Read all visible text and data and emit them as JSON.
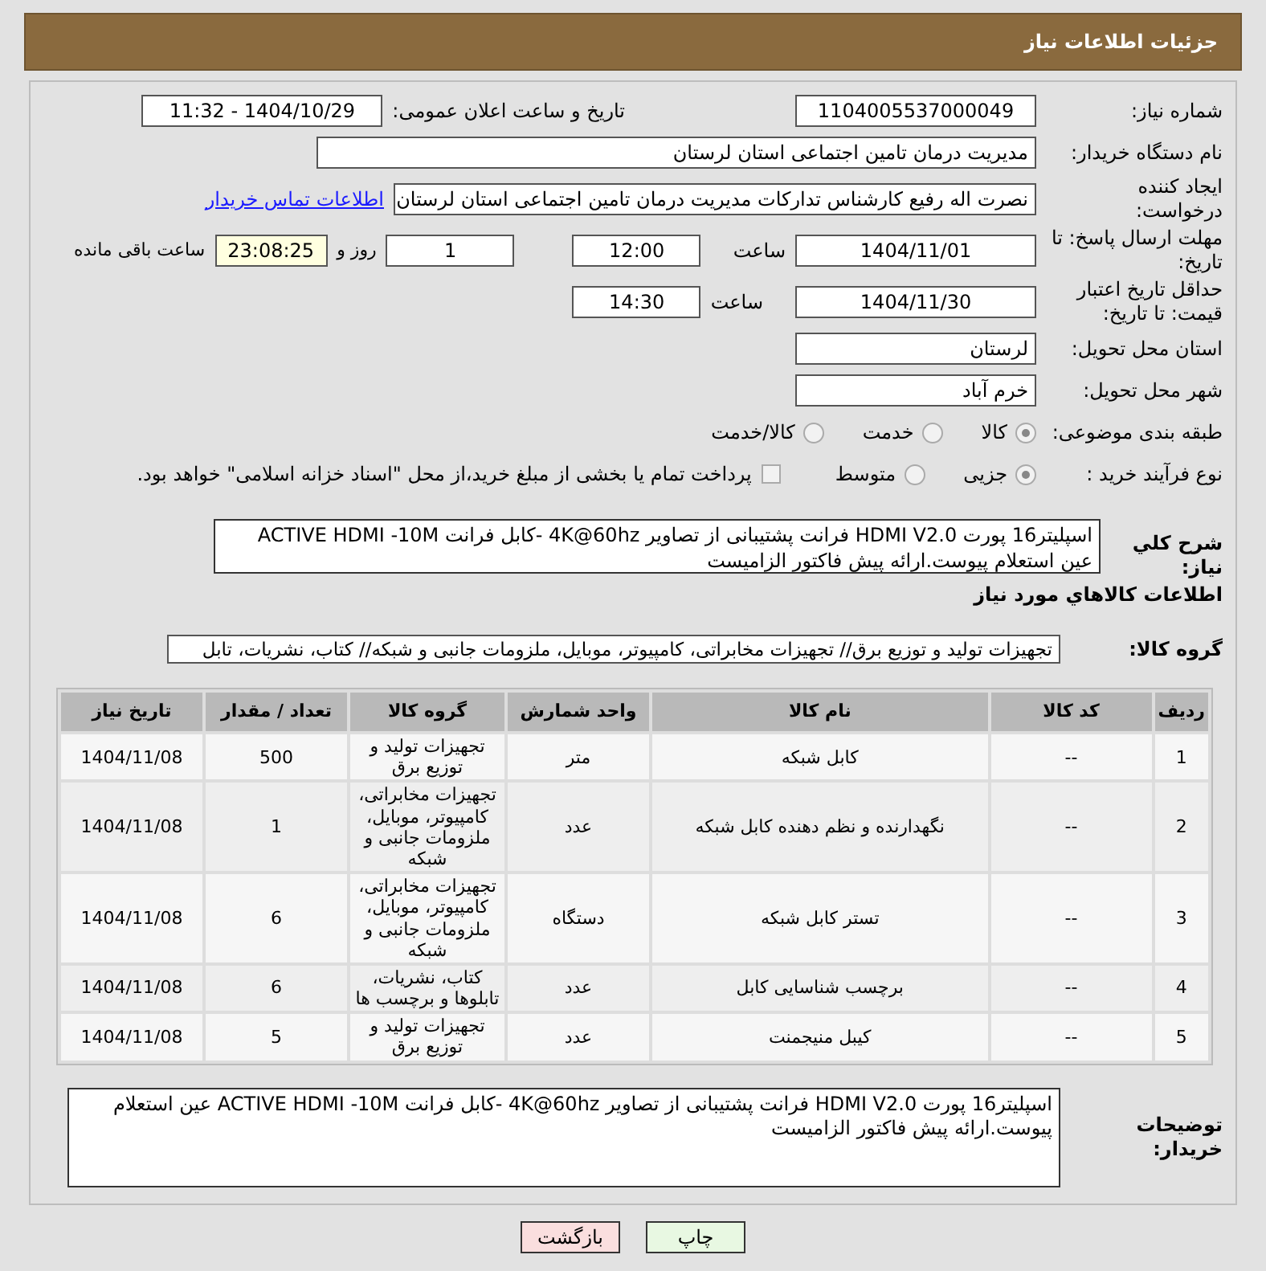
{
  "header": {
    "title": "جزئیات اطلاعات نیاز"
  },
  "need_number": {
    "label": "شماره نیاز:",
    "value": "1104005537000049"
  },
  "announce": {
    "label": "تاریخ و ساعت اعلان عمومی:",
    "value": "1404/10/29 - 11:32"
  },
  "buyer_org": {
    "label": "نام دستگاه خریدار:",
    "value": "مدیریت درمان تامین اجتماعی استان لرستان"
  },
  "requester": {
    "label": "ایجاد کننده درخواست:",
    "value": "نصرت اله رفیع کارشناس تدارکات مدیریت درمان تامین اجتماعی استان لرستان",
    "contact_link": "اطلاعات تماس خریدار"
  },
  "reply_deadline": {
    "label": "مهلت ارسال پاسخ: تا تاریخ:",
    "date": "1404/11/01",
    "time_label": "ساعت",
    "time": "12:00",
    "days": "1",
    "days_label": "روز و",
    "remaining": "23:08:25",
    "remaining_label": "ساعت باقی مانده"
  },
  "price_validity": {
    "label": "حداقل تاریخ اعتبار قیمت: تا تاریخ:",
    "date": "1404/11/30",
    "time_label": "ساعت",
    "time": "14:30"
  },
  "province": {
    "label": "استان محل تحویل:",
    "value": "لرستان"
  },
  "city": {
    "label": "شهر محل تحویل:",
    "value": "خرم آباد"
  },
  "category": {
    "label": "طبقه بندی موضوعی:",
    "options": [
      {
        "label": "کالا",
        "selected": true
      },
      {
        "label": "خدمت",
        "selected": false
      },
      {
        "label": "کالا/خدمت",
        "selected": false
      }
    ]
  },
  "process": {
    "label": "نوع فرآیند خرید :",
    "options": [
      {
        "label": "جزیی",
        "selected": true
      },
      {
        "label": "متوسط",
        "selected": false
      }
    ],
    "payment": {
      "checked": false,
      "label": "پرداخت تمام یا بخشی از مبلغ خرید،از محل \"اسناد خزانه اسلامی\" خواهد بود."
    }
  },
  "description": {
    "label": "شرح کلي نياز:",
    "value": "اسپلیتر16 پورت HDMI V2.0 فرانت  پشتیبانی از تصاویر 4K@60hz  -کابل فرانت ACTIVE HDMI -10M عین استعلام پیوست.ارائه پیش فاکتور الزامیست"
  },
  "goods_section_title": "اطلاعات کالاهاي مورد نياز",
  "goods_group": {
    "label": "گروه کالا:",
    "value": "تجهیزات تولید و توزیع برق// تجهیزات مخابراتی، کامپیوتر، موبایل، ملزومات جانبی و شبکه// کتاب، نشریات، تابل"
  },
  "table": {
    "columns": [
      "ردیف",
      "کد کالا",
      "نام کالا",
      "واحد شمارش",
      "گروه کالا",
      "تعداد / مقدار",
      "تاریخ نیاز"
    ],
    "rows": [
      [
        "1",
        "--",
        "کابل شبکه",
        "متر",
        "تجهیزات تولید و توزیع برق",
        "500",
        "1404/11/08"
      ],
      [
        "2",
        "--",
        "نگهدارنده و نظم دهنده کابل شبکه",
        "عدد",
        "تجهیزات مخابراتی، کامپیوتر، موبایل، ملزومات جانبی و شبکه",
        "1",
        "1404/11/08"
      ],
      [
        "3",
        "--",
        "تستر کابل شبکه",
        "دستگاه",
        "تجهیزات مخابراتی، کامپیوتر، موبایل، ملزومات جانبی و شبکه",
        "6",
        "1404/11/08"
      ],
      [
        "4",
        "--",
        "برچسب شناسایی کابل",
        "عدد",
        "کتاب، نشریات، تابلوها و برچسب ها",
        "6",
        "1404/11/08"
      ],
      [
        "5",
        "--",
        "کیبل منیجمنت",
        "عدد",
        "تجهیزات تولید و توزیع برق",
        "5",
        "1404/11/08"
      ]
    ]
  },
  "buyer_notes": {
    "label": "توضیحات خریدار:",
    "value": "اسپلیتر16 پورت HDMI V2.0 فرانت  پشتیبانی از تصاویر 4K@60hz  -کابل فرانت ACTIVE HDMI -10M عین استعلام پیوست.ارائه پیش فاکتور الزامیست"
  },
  "buttons": [
    {
      "label": "چاپ",
      "kind": "print"
    },
    {
      "label": "بازگشت",
      "kind": "back"
    }
  ]
}
